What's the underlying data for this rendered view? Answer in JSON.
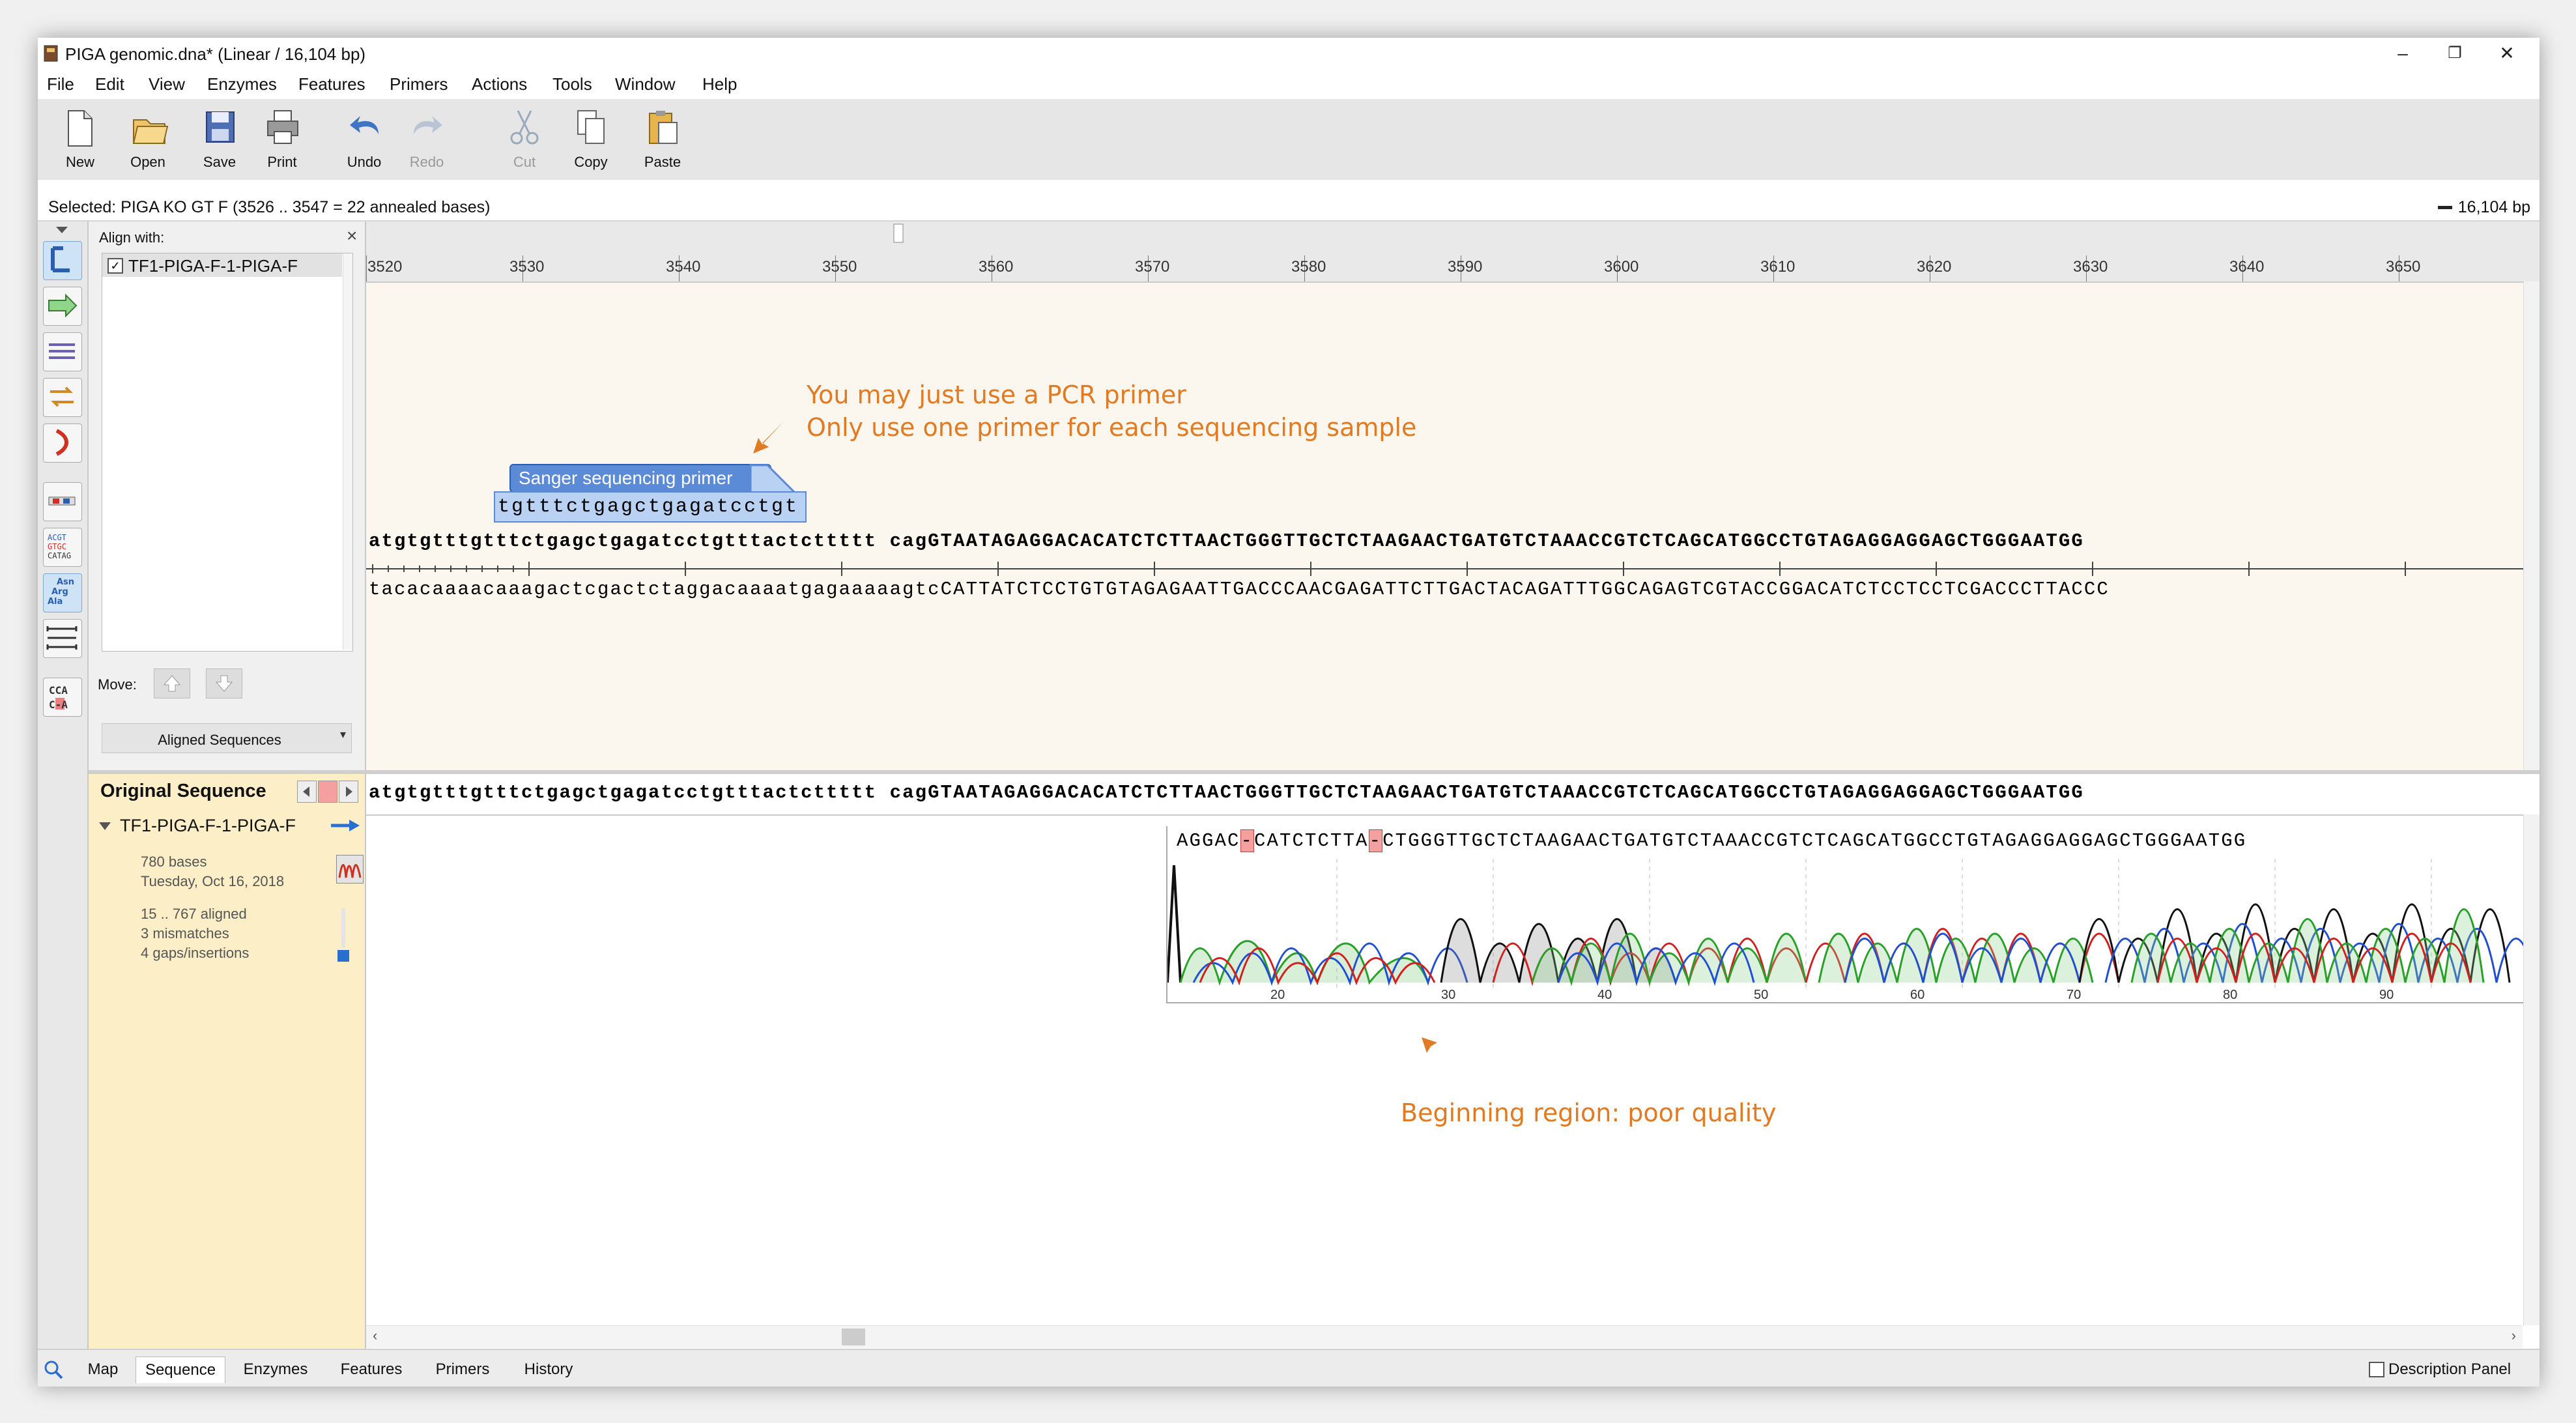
{
  "window": {
    "title": "PIGA genomic.dna*  (Linear / 16,104 bp)",
    "controls": {
      "minimize": "–",
      "maximize": "❐",
      "close": "✕"
    }
  },
  "menu": [
    "File",
    "Edit",
    "View",
    "Enzymes",
    "Features",
    "Primers",
    "Actions",
    "Tools",
    "Window",
    "Help"
  ],
  "toolbar": {
    "new": "New",
    "open": "Open",
    "save": "Save",
    "print": "Print",
    "undo": "Undo",
    "redo": "Redo",
    "cut": "Cut",
    "copy": "Copy",
    "paste": "Paste"
  },
  "status": {
    "selected": "Selected:  PIGA KO GT F  (3526 .. 3547  =  22 annealed bases)",
    "length": "16,104 bp"
  },
  "align_panel": {
    "header": "Align with:",
    "close": "×",
    "item": "TF1-PIGA-F-1-PIGA-F",
    "move_label": "Move:",
    "dropdown": "Aligned Sequences"
  },
  "ruler_ticks": [
    "3520",
    "3530",
    "3540",
    "3550",
    "3560",
    "3570",
    "3580",
    "3590",
    "3600",
    "3610",
    "3620",
    "3630",
    "3640",
    "3650"
  ],
  "sequence": {
    "top_strand": "atgtgtttgtttctgagctgagatcctgtttactcttttt cagGTAATAGAGGACACATCTCTTAACTGGGTTGCTCTAAGAACTGATGTCTAAACCGTCTCAGCATGGCCTGTAGAGGAGGAGCTGGGAATGG",
    "bottom_strand": "tacacaaaacaaagactcgactctaggacaaaatgagaaaaagtcCATTATCTCCTGTGTAGAGAATTGACCCAACGAGATTCTTGACTACAGATTTGGCAGAGTCGTACCGGACATCTCCTCCTCGACCCTTACCC",
    "primer_label": "Sanger sequencing primer",
    "primer_seq": "tgtttctgagctgagatcctgt"
  },
  "annotations": {
    "primer_note_1": "You may just use a PCR primer",
    "primer_note_2": "Only use one primer for each sequencing sample",
    "quality_note": "Beginning region: poor quality"
  },
  "original_panel": {
    "title": "Original Sequence",
    "seq_name": "TF1-PIGA-F-1-PIGA-F",
    "bases": "780 bases",
    "date": "Tuesday, Oct 16, 2018",
    "aligned": "15 .. 767 aligned",
    "mismatches": "3 mismatches",
    "gaps": "4 gaps/insertions"
  },
  "trace": {
    "seq_a": "AGGAC",
    "gap1": "-",
    "seq_b": "CATCTCTTA",
    "gap2": "-",
    "seq_c": "CTGGGTTGCTCTAAGAACTGATGTCTAAACCGTCTCAGCATGGCCTGTAGAGGAGGAGCTGGGAATGG",
    "positions": [
      "20",
      "30",
      "40",
      "50",
      "60",
      "70",
      "80",
      "90"
    ]
  },
  "tabs": [
    "Map",
    "Sequence",
    "Enzymes",
    "Features",
    "Primers",
    "History"
  ],
  "active_tab": "Sequence",
  "description_panel": "Description Panel"
}
